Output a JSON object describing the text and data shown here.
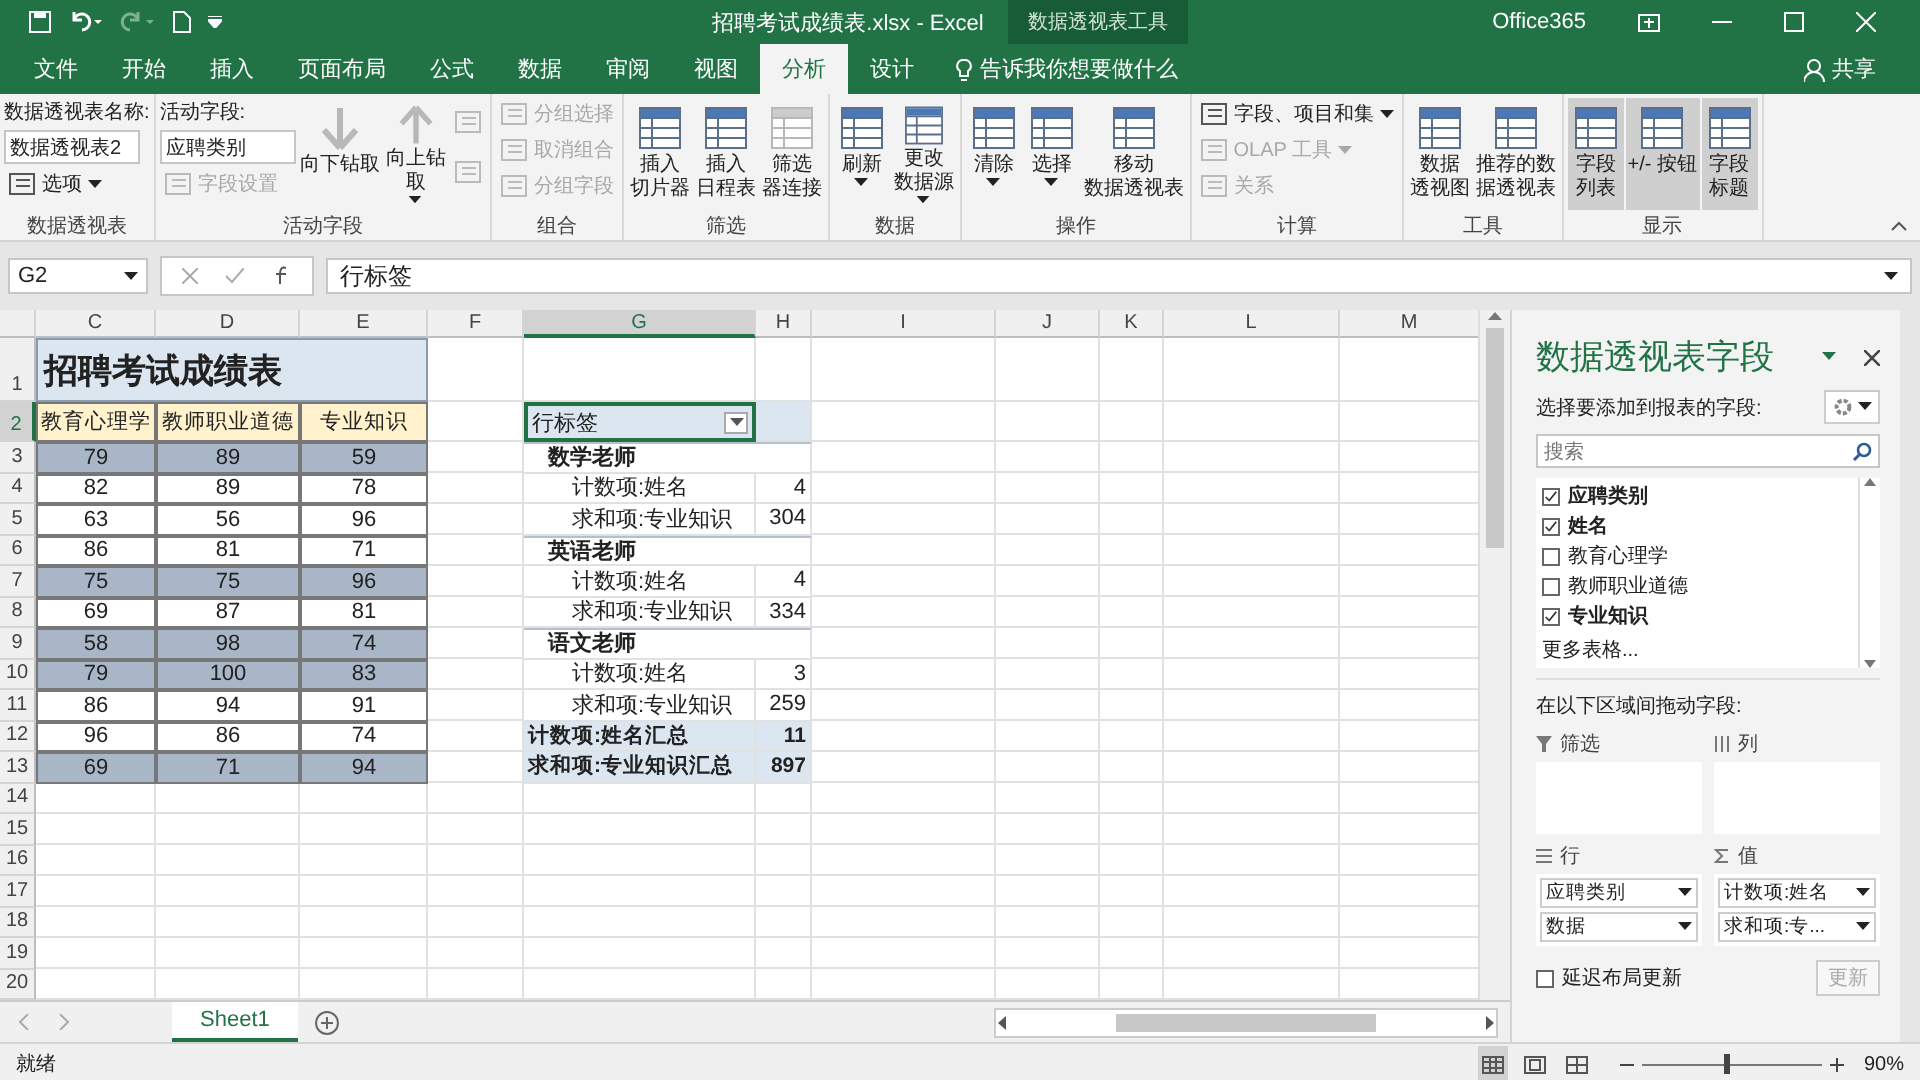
{
  "window": {
    "title": "招聘考试成绩表.xlsx - Excel",
    "context_tab": "数据透视表工具",
    "account": "Office365"
  },
  "ribbon_tabs": [
    {
      "label": "文件",
      "selected": false
    },
    {
      "label": "开始",
      "selected": false
    },
    {
      "label": "插入",
      "selected": false
    },
    {
      "label": "页面布局",
      "selected": false
    },
    {
      "label": "公式",
      "selected": false
    },
    {
      "label": "数据",
      "selected": false
    },
    {
      "label": "审阅",
      "selected": false
    },
    {
      "label": "视图",
      "selected": false
    },
    {
      "label": "分析",
      "selected": true
    },
    {
      "label": "设计",
      "selected": false
    }
  ],
  "tell_me": "告诉我你想要做什么",
  "share": "共享",
  "ribbon_groups": [
    {
      "label": "数据透视表",
      "columns": [
        [
          {
            "kind": "label",
            "text": "数据透视表名称:"
          },
          {
            "kind": "input",
            "value": "数据透视表2"
          },
          {
            "kind": "small",
            "label": "选项",
            "disabled": false,
            "menu": true
          }
        ]
      ]
    },
    {
      "label": "活动字段",
      "columns": [
        [
          {
            "kind": "label",
            "text": "活动字段:"
          },
          {
            "kind": "input",
            "value": "应聘类别"
          },
          {
            "kind": "small",
            "label": "字段设置",
            "disabled": true,
            "menu": false
          }
        ],
        [
          {
            "kind": "large",
            "lines": [
              "向下钻取"
            ],
            "disabled": true,
            "menu": false,
            "selected": false
          }
        ],
        [
          {
            "kind": "large",
            "lines": [
              "向上钻",
              "取"
            ],
            "disabled": true,
            "menu": true,
            "selected": false
          }
        ],
        [
          {
            "kind": "icon",
            "disabled": true
          },
          {
            "kind": "icon",
            "disabled": true
          }
        ]
      ]
    },
    {
      "label": "组合",
      "columns": [
        [
          {
            "kind": "small",
            "label": "分组选择",
            "disabled": true,
            "menu": false
          },
          {
            "kind": "small",
            "label": "取消组合",
            "disabled": true,
            "menu": false
          },
          {
            "kind": "small",
            "label": "分组字段",
            "disabled": true,
            "menu": false
          }
        ]
      ]
    },
    {
      "label": "筛选",
      "columns": [
        [
          {
            "kind": "large",
            "lines": [
              "插入",
              "切片器"
            ],
            "disabled": false,
            "menu": false,
            "selected": false
          }
        ],
        [
          {
            "kind": "large",
            "lines": [
              "插入",
              "日程表"
            ],
            "disabled": false,
            "menu": false,
            "selected": false
          }
        ],
        [
          {
            "kind": "large",
            "lines": [
              "筛选",
              "器连接"
            ],
            "disabled": true,
            "menu": false,
            "selected": false
          }
        ]
      ]
    },
    {
      "label": "数据",
      "columns": [
        [
          {
            "kind": "large",
            "lines": [
              "刷新"
            ],
            "disabled": false,
            "menu": true,
            "selected": false
          }
        ],
        [
          {
            "kind": "large",
            "lines": [
              "更改",
              "数据源"
            ],
            "disabled": false,
            "menu": true,
            "selected": false
          }
        ]
      ]
    },
    {
      "label": "操作",
      "columns": [
        [
          {
            "kind": "large",
            "lines": [
              "清除"
            ],
            "disabled": false,
            "menu": true,
            "selected": false
          }
        ],
        [
          {
            "kind": "large",
            "lines": [
              "选择"
            ],
            "disabled": false,
            "menu": true,
            "selected": false
          }
        ],
        [
          {
            "kind": "large",
            "lines": [
              "移动",
              "数据透视表"
            ],
            "disabled": false,
            "menu": false,
            "selected": false
          }
        ]
      ]
    },
    {
      "label": "计算",
      "columns": [
        [
          {
            "kind": "small",
            "label": "字段、项目和集",
            "disabled": false,
            "menu": true
          },
          {
            "kind": "small",
            "label": "OLAP 工具",
            "disabled": true,
            "menu": true
          },
          {
            "kind": "small",
            "label": "关系",
            "disabled": true,
            "menu": false
          }
        ]
      ]
    },
    {
      "label": "工具",
      "columns": [
        [
          {
            "kind": "large",
            "lines": [
              "数据",
              "透视图"
            ],
            "disabled": false,
            "menu": false,
            "selected": false
          }
        ],
        [
          {
            "kind": "large",
            "lines": [
              "推荐的数",
              "据透视表"
            ],
            "disabled": false,
            "menu": false,
            "selected": false
          }
        ]
      ]
    },
    {
      "label": "显示",
      "columns": [
        [
          {
            "kind": "large",
            "lines": [
              "字段",
              "列表"
            ],
            "disabled": false,
            "menu": false,
            "selected": true
          }
        ],
        [
          {
            "kind": "large",
            "lines": [
              "+/- 按钮"
            ],
            "disabled": false,
            "menu": false,
            "selected": true
          }
        ],
        [
          {
            "kind": "large",
            "lines": [
              "字段",
              "标题"
            ],
            "disabled": false,
            "menu": false,
            "selected": true
          }
        ]
      ]
    }
  ],
  "formula_bar": {
    "name_box": "G2",
    "formula": "行标签"
  },
  "sheet": {
    "columns": [
      {
        "label": "C",
        "selected": false
      },
      {
        "label": "D",
        "selected": false
      },
      {
        "label": "E",
        "selected": false
      },
      {
        "label": "F",
        "selected": false
      },
      {
        "label": "G",
        "selected": true
      },
      {
        "label": "H",
        "selected": false
      },
      {
        "label": "I",
        "selected": false
      },
      {
        "label": "J",
        "selected": false
      },
      {
        "label": "K",
        "selected": false
      },
      {
        "label": "L",
        "selected": false
      },
      {
        "label": "M",
        "selected": false
      }
    ],
    "row_headers": [
      {
        "label": "1",
        "selected": false
      },
      {
        "label": "2",
        "selected": true
      },
      {
        "label": "3",
        "selected": false
      },
      {
        "label": "4",
        "selected": false
      },
      {
        "label": "5",
        "selected": false
      },
      {
        "label": "6",
        "selected": false
      },
      {
        "label": "7",
        "selected": false
      },
      {
        "label": "8",
        "selected": false
      },
      {
        "label": "9",
        "selected": false
      },
      {
        "label": "10",
        "selected": false
      },
      {
        "label": "11",
        "selected": false
      },
      {
        "label": "12",
        "selected": false
      },
      {
        "label": "13",
        "selected": false
      },
      {
        "label": "14",
        "selected": false
      },
      {
        "label": "15",
        "selected": false
      },
      {
        "label": "16",
        "selected": false
      },
      {
        "label": "17",
        "selected": false
      },
      {
        "label": "18",
        "selected": false
      },
      {
        "label": "19",
        "selected": false
      },
      {
        "label": "20",
        "selected": false
      }
    ],
    "score_table": {
      "title": "招聘考试成绩表",
      "headers": [
        "教育心理学",
        "教师职业道德",
        "专业知识"
      ],
      "rows": [
        {
          "values": [
            "79",
            "89",
            "59"
          ],
          "highlighted": true
        },
        {
          "values": [
            "82",
            "89",
            "78"
          ],
          "highlighted": false
        },
        {
          "values": [
            "63",
            "56",
            "96"
          ],
          "highlighted": false
        },
        {
          "values": [
            "86",
            "81",
            "71"
          ],
          "highlighted": false
        },
        {
          "values": [
            "75",
            "75",
            "96"
          ],
          "highlighted": true
        },
        {
          "values": [
            "69",
            "87",
            "81"
          ],
          "highlighted": false
        },
        {
          "values": [
            "58",
            "98",
            "74"
          ],
          "highlighted": true
        },
        {
          "values": [
            "79",
            "100",
            "83"
          ],
          "highlighted": true
        },
        {
          "values": [
            "86",
            "94",
            "91"
          ],
          "highlighted": false
        },
        {
          "values": [
            "96",
            "86",
            "74"
          ],
          "highlighted": false
        },
        {
          "values": [
            "69",
            "71",
            "94"
          ],
          "highlighted": true
        }
      ]
    },
    "pivot": {
      "header": "行标签",
      "groups": [
        {
          "label": "数学老师",
          "children": [
            {
              "label": "计数项:姓名",
              "value": "4"
            },
            {
              "label": "求和项:专业知识",
              "value": "304"
            }
          ]
        },
        {
          "label": "英语老师",
          "children": [
            {
              "label": "计数项:姓名",
              "value": "4"
            },
            {
              "label": "求和项:专业知识",
              "value": "334"
            }
          ]
        },
        {
          "label": "语文老师",
          "children": [
            {
              "label": "计数项:姓名",
              "value": "3"
            },
            {
              "label": "求和项:专业知识",
              "value": "259"
            }
          ]
        }
      ],
      "totals": [
        {
          "label": "计数项:姓名汇总",
          "value": "11"
        },
        {
          "label": "求和项:专业知识汇总",
          "value": "897"
        }
      ]
    }
  },
  "sheet_tabs": [
    {
      "label": "Sheet1",
      "selected": true
    }
  ],
  "field_pane": {
    "title": "数据透视表字段",
    "subtitle": "选择要添加到报表的字段:",
    "search_placeholder": "搜索",
    "fields": [
      {
        "label": "应聘类别",
        "checked": true
      },
      {
        "label": "姓名",
        "checked": true
      },
      {
        "label": "教育心理学",
        "checked": false
      },
      {
        "label": "教师职业道德",
        "checked": false
      },
      {
        "label": "专业知识",
        "checked": true
      }
    ],
    "more": "更多表格...",
    "drag_hint": "在以下区域间拖动字段:",
    "areas": [
      {
        "kind": "filter",
        "label": "筛选"
      },
      {
        "kind": "columns",
        "label": "列"
      },
      {
        "kind": "rows",
        "label": "行",
        "items": [
          "应聘类别",
          "数据"
        ]
      },
      {
        "kind": "values",
        "label": "值",
        "items": [
          "计数项:姓名",
          "求和项:专..."
        ]
      }
    ],
    "defer": {
      "label": "延迟布局更新",
      "checked": false
    },
    "update_button": "更新"
  },
  "status_bar": {
    "status": "就绪",
    "views": [
      {
        "kind": "normal",
        "selected": true
      },
      {
        "kind": "page_layout",
        "selected": false
      },
      {
        "kind": "page_break",
        "selected": false
      }
    ],
    "zoom": {
      "level": 0.47,
      "reading": "90%"
    }
  }
}
